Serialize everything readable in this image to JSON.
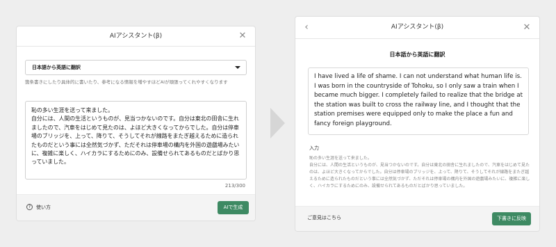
{
  "left_panel": {
    "title": "AIアシスタント(β)",
    "close_icon": "close-icon",
    "mode_select": "日本語から英語に翻訳",
    "hint": "箇条書きにしたり具体的に書いたり、参考になる情報を増やすほどAIが頑張ってくれやすくなります",
    "input_text": "恥の多い生涯を送って来ました。\n自分には、人間の生活というものが、見当つかないのです。自分は東北の田舎に生れましたので、汽車をはじめて見たのは、よほど大きくなってからでした。自分は停車場のブリッジを、上って、降りて、そうしてそれが線路をまたぎ越えるために造られたものだという事には全然気づかず、ただそれは停車場の構内を外国の遊戯場みたいに、複雑に楽しく、ハイカラにするためにのみ、設備せられてあるものだとばかり思っていました。",
    "counter": "213/300",
    "help_label": "使い方",
    "help_icon": "question-icon",
    "generate_label": "AIで生成"
  },
  "right_panel": {
    "title": "AIアシスタント(β)",
    "back_icon": "chevron-left-icon",
    "close_icon": "close-icon",
    "section_title": "日本語から英語に翻訳",
    "result_text": "I have lived a life of shame. I can not understand what human life is. I was born in the countryside of Tohoku, so I only saw a train when I became much bigger. I completely failed to realize that the bridge at the station was built to cross the railway line, and I thought that the station premises were equipped only to make the place a fun and fancy foreign playground.",
    "input_label": "入力",
    "input_echo": "恥の多い生涯を送って来ました。\n自分には、人間の生活というものが、見当つかないのです。自分は東北の田舎に生れましたので、汽車をはじめて見たのは、よほど大きくなってからでした。自分は停車場のブリッジを、上って、降りて、そうしてそれが線路をまたぎ越えるために造られたものだという事には全然気づかず、ただそれは停車場の構内を外国の遊戯場みたいに、複雑に楽しく、ハイカラにするためにのみ、設備せられてあるものだとばかり思っていました。",
    "feedback_label": "ご意見はこちら",
    "reflect_label": "下書きに反映"
  },
  "colors": {
    "accent": "#3e8a63",
    "background": "#eeeeee",
    "arrow": "#d6d6d6"
  }
}
